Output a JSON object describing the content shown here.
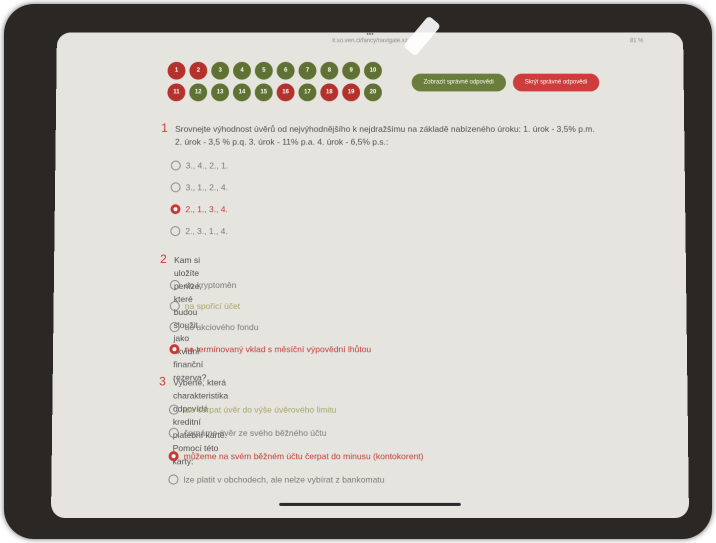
{
  "status": {
    "url": "lr.so.ven.cl/fancy/navigate.xz",
    "right": "81 %"
  },
  "nav": {
    "row1": [
      {
        "label": "1",
        "color": "#b3322c"
      },
      {
        "label": "2",
        "color": "#b3322c"
      },
      {
        "label": "3",
        "color": "#5f7133"
      },
      {
        "label": "4",
        "color": "#5f7133"
      },
      {
        "label": "5",
        "color": "#5f7133"
      },
      {
        "label": "6",
        "color": "#5f7133"
      },
      {
        "label": "7",
        "color": "#5f7133"
      },
      {
        "label": "8",
        "color": "#5f7133"
      },
      {
        "label": "9",
        "color": "#5f7133"
      },
      {
        "label": "10",
        "color": "#5f7133"
      }
    ],
    "row2": [
      {
        "label": "11",
        "color": "#b3322c"
      },
      {
        "label": "12",
        "color": "#5f7133"
      },
      {
        "label": "13",
        "color": "#5f7133"
      },
      {
        "label": "14",
        "color": "#5f7133"
      },
      {
        "label": "15",
        "color": "#5f7133"
      },
      {
        "label": "16",
        "color": "#b3322c"
      },
      {
        "label": "17",
        "color": "#5f7133"
      },
      {
        "label": "18",
        "color": "#b3322c"
      },
      {
        "label": "19",
        "color": "#b3322c"
      },
      {
        "label": "20",
        "color": "#5f7133"
      }
    ]
  },
  "buttons": {
    "show_correct": "Zobrazit správné odpovědi",
    "hide_correct": "Skrýt správné odpovědi"
  },
  "questions": [
    {
      "number": "1",
      "text_line1": "Srovnejte výhodnost úvěrů od nejvýhodnějšího k nejdražšímu na základě nabízeného úroku: 1. úrok - 3,5% p.m.",
      "text_line2": "2. úrok - 3,5 % p.q. 3. úrok - 11% p.a. 4. úrok - 6,5% p.s.:",
      "options": [
        {
          "label": "3., 4., 2., 1.",
          "state": "plain"
        },
        {
          "label": "3., 1., 2., 4.",
          "state": "plain"
        },
        {
          "label": "2., 1., 3., 4.",
          "state": "selected"
        },
        {
          "label": "2., 3., 1., 4.",
          "state": "plain"
        }
      ]
    },
    {
      "number": "2",
      "text_line1": "Kam si uložíte peníze, které budou sloužit jako likvidní finanční rezerva?",
      "options": [
        {
          "label": "do kryptoměn",
          "state": "plain"
        },
        {
          "label": "na spořicí účet",
          "state": "colored"
        },
        {
          "label": "do akciového fondu",
          "state": "plain"
        },
        {
          "label": "na termínovaný vklad s měsíční výpovědní lhůtou",
          "state": "selected"
        }
      ]
    },
    {
      "number": "3",
      "text_line1": "Vyberte, která charakteristika odpovídá kreditní platební kartě. Pomocí této karty:",
      "options": [
        {
          "label": "lze čerpat úvěr do výše úvěrového limitu",
          "state": "colored"
        },
        {
          "label": "čerpáme úvěr ze svého běžného účtu",
          "state": "plain"
        },
        {
          "label": "můžeme na svém běžném účtu čerpat do minusu (kontokorent)",
          "state": "selected"
        },
        {
          "label": "lze platit v obchodech, ale nelze vybírat z bankomatu",
          "state": "plain"
        }
      ]
    }
  ]
}
